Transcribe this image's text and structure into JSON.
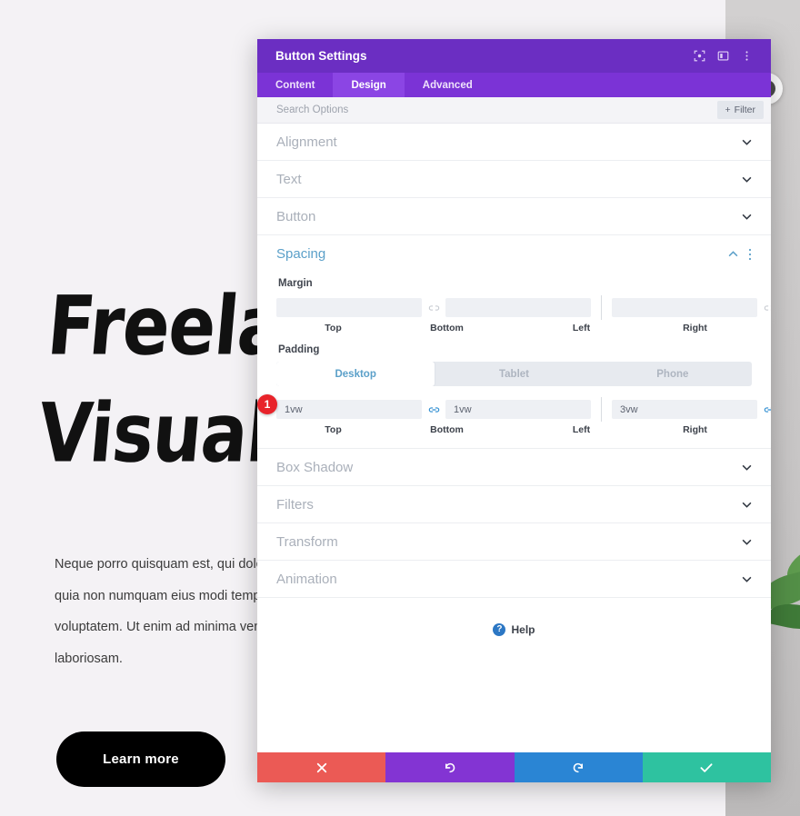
{
  "background": {
    "hero_title_line1": "Freelan",
    "hero_title_line2": "Visual",
    "body_text": "Neque porro quisquam est, qui dolorem ipsum sed quia non numquam eius modi tempora quaerat voluptatem. Ut enim ad minima veniam suscipit laboriosam.",
    "cta_label": "Learn more",
    "close_icon": "✕"
  },
  "modal": {
    "title": "Button Settings",
    "header_icons": [
      {
        "name": "fullscreen-icon",
        "glyph": "⛶"
      },
      {
        "name": "layout-toggle-icon",
        "glyph": "▤"
      },
      {
        "name": "more-options-icon",
        "glyph": "⋮"
      }
    ],
    "tabs": [
      {
        "label": "Content",
        "active": false
      },
      {
        "label": "Design",
        "active": true
      },
      {
        "label": "Advanced",
        "active": false
      }
    ],
    "search": {
      "placeholder": "Search Options",
      "value": ""
    },
    "filter_label": "Filter",
    "filter_plus": "+",
    "sections_above": [
      {
        "label": "Alignment"
      },
      {
        "label": "Text"
      },
      {
        "label": "Button"
      }
    ],
    "spacing": {
      "label": "Spacing",
      "expanded": true,
      "chevron": "⌃",
      "kebab": "⋮",
      "margin": {
        "label": "Margin",
        "linked": false,
        "values": {
          "top": "",
          "bottom": "",
          "left": "",
          "right": ""
        },
        "placeholders": {
          "top": "",
          "bottom": "",
          "left": "",
          "right": ""
        },
        "labels": [
          "Top",
          "Bottom",
          "Left",
          "Right"
        ]
      },
      "padding": {
        "label": "Padding",
        "linked": true,
        "values": {
          "top": "1vw",
          "bottom": "1vw",
          "left": "3vw",
          "right": "3vw"
        },
        "labels": [
          "Top",
          "Bottom",
          "Left",
          "Right"
        ]
      },
      "device_tabs": [
        {
          "label": "Desktop",
          "active": true
        },
        {
          "label": "Tablet",
          "active": false
        },
        {
          "label": "Phone",
          "active": false
        }
      ]
    },
    "sections_below": [
      {
        "label": "Box Shadow"
      },
      {
        "label": "Filters"
      },
      {
        "label": "Transform"
      },
      {
        "label": "Animation"
      }
    ],
    "help": {
      "label": "Help",
      "icon_glyph": "?"
    },
    "actions": [
      {
        "name": "cancel",
        "glyph": "✕",
        "color": "#eb5a55"
      },
      {
        "name": "undo",
        "glyph": "↺",
        "color": "#8334d3"
      },
      {
        "name": "redo",
        "glyph": "↻",
        "color": "#2a85d4"
      },
      {
        "name": "save",
        "glyph": "✔",
        "color": "#2ec2a0"
      }
    ]
  },
  "marker": {
    "number": "1"
  }
}
